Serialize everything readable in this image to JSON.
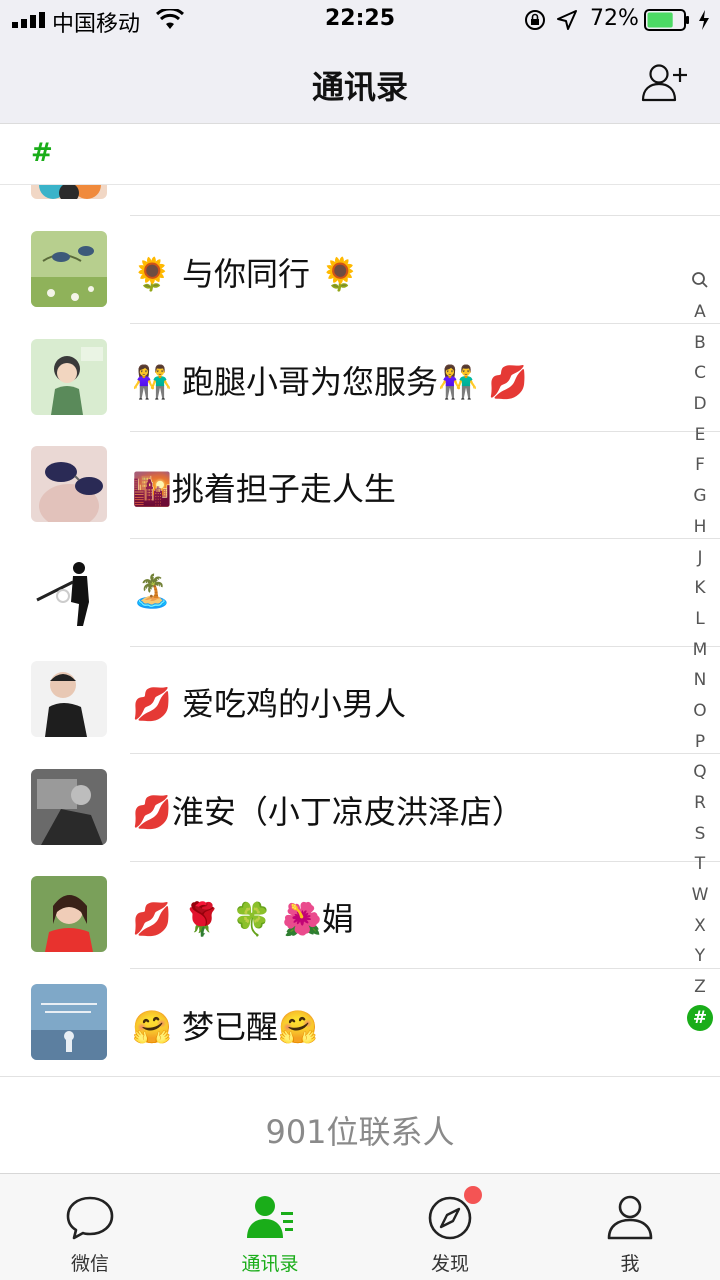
{
  "status_bar": {
    "carrier": "中国移动",
    "time": "22:25",
    "battery_percent": "72%",
    "battery_level": 0.72
  },
  "nav": {
    "title": "通讯录"
  },
  "section": {
    "letter": "#"
  },
  "contacts": [
    {
      "name": ""
    },
    {
      "name": "🌻 与你同行 🌻"
    },
    {
      "name": "👫  跑腿小哥为您服务👫 💋"
    },
    {
      "name": "🌇挑着担子走人生"
    },
    {
      "name": "🏝️"
    },
    {
      "name": "💋 爱吃鸡的小男人"
    },
    {
      "name": "💋淮安（小丁凉皮洪泽店）"
    },
    {
      "name": "💋 🌹 🍀 🌺娟"
    },
    {
      "name": "🤗 梦已醒🤗"
    }
  ],
  "index_letters": [
    "A",
    "B",
    "C",
    "D",
    "E",
    "F",
    "G",
    "H",
    "J",
    "K",
    "L",
    "M",
    "N",
    "O",
    "P",
    "Q",
    "R",
    "S",
    "T",
    "W",
    "X",
    "Y",
    "Z",
    "#"
  ],
  "footer": {
    "count": "901位联系人"
  },
  "tabs": [
    {
      "label": "微信",
      "icon": "chat-bubble-icon"
    },
    {
      "label": "通讯录",
      "icon": "contacts-icon"
    },
    {
      "label": "发现",
      "icon": "compass-icon"
    },
    {
      "label": "我",
      "icon": "person-icon"
    }
  ],
  "colors": {
    "accent": "#1aad19",
    "badge": "#f45454",
    "nav_bg": "#efeff4"
  }
}
